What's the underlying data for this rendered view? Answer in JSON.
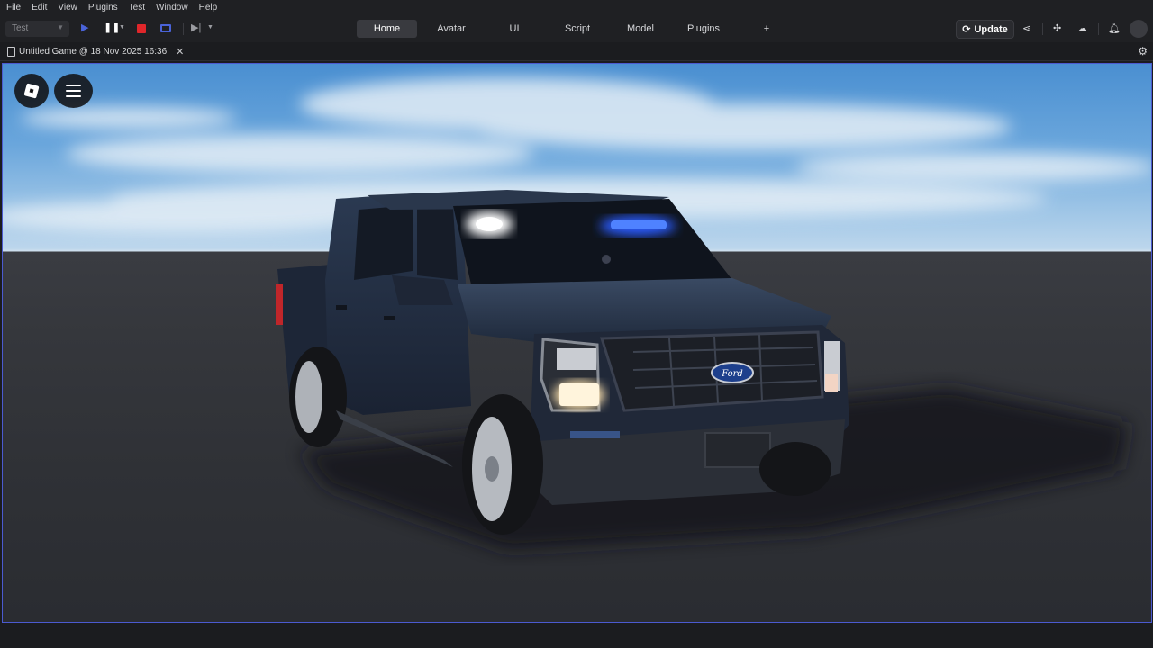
{
  "menu": [
    "File",
    "Edit",
    "View",
    "Plugins",
    "Test",
    "Window",
    "Help"
  ],
  "toolbar": {
    "mode": "Test",
    "tabs": [
      "Home",
      "Avatar",
      "UI",
      "Script",
      "Model",
      "Plugins",
      "+"
    ],
    "active_tab": "Home",
    "update_label": "Update"
  },
  "document": {
    "tab_title": "Untitled Game @ 18 Nov 2025 16:36"
  },
  "viewport": {
    "scene": "navy pickup truck with blue and white emergency lights on flat baseplate",
    "overlay_buttons": [
      "roblox-menu",
      "hamburger-menu"
    ]
  },
  "colors": {
    "accent": "#4b5ad0",
    "stop_red": "#e0262a",
    "play_blue": "#4a63d8",
    "light_blue": "#2a5bff"
  },
  "icons": [
    "play-icon",
    "pause-icon",
    "stop-icon",
    "screen-icon",
    "step-icon",
    "roblox-logo-icon",
    "share-icon",
    "collaborate-icon",
    "cloud-icon",
    "bell-icon",
    "gear-icon",
    "document-icon",
    "close-icon",
    "hamburger-icon"
  ]
}
